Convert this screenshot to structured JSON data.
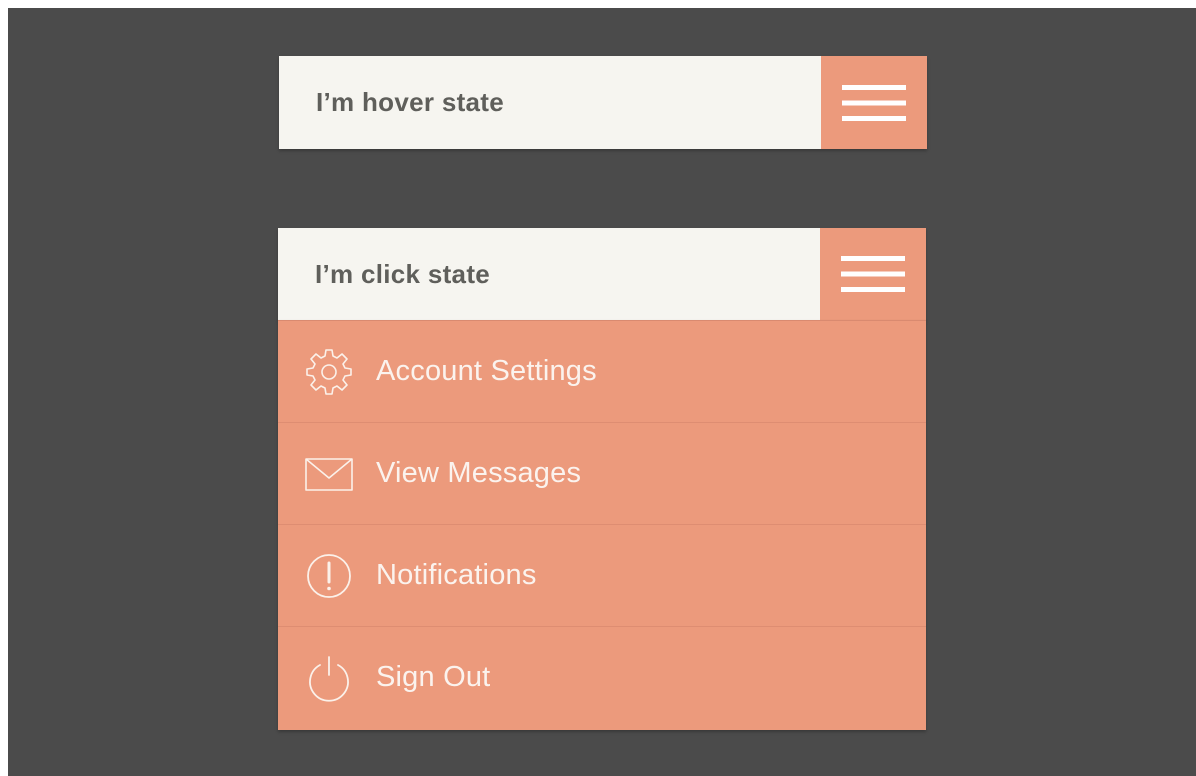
{
  "colors": {
    "background": "#4b4b4b",
    "bar": "#f6f5f0",
    "accent": "#ec9a7c",
    "label": "#5f5f5b",
    "menu_text": "#fbf3ee"
  },
  "hover_bar": {
    "label": "I’m hover state",
    "menu_icon": "hamburger-icon"
  },
  "click_bar": {
    "label": "I’m click state",
    "menu_icon": "hamburger-icon"
  },
  "dropdown": {
    "items": [
      {
        "label": "Account Settings",
        "icon": "gear-icon"
      },
      {
        "label": "View Messages",
        "icon": "envelope-icon"
      },
      {
        "label": "Notifications",
        "icon": "exclamation-icon"
      },
      {
        "label": "Sign Out",
        "icon": "power-icon"
      }
    ]
  }
}
